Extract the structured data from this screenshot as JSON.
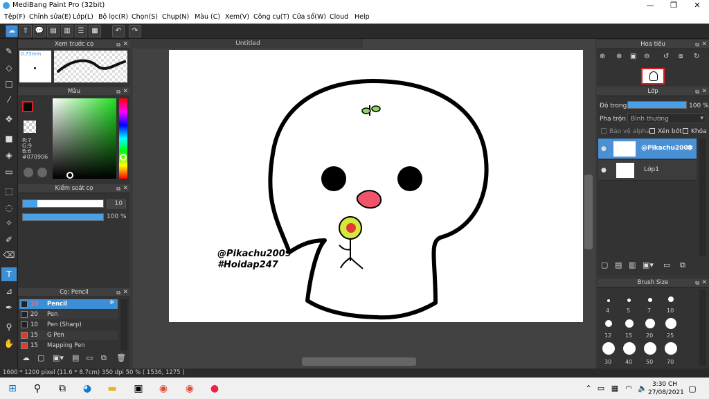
{
  "app": {
    "title": "MediBang Paint Pro (32bit)",
    "min": "—",
    "max": "❐",
    "close": "✕"
  },
  "menu": [
    "Tệp(F)",
    "Chỉnh sửa(E)",
    "Lớp(L)",
    "Bộ lọc(R)",
    "Chọn(S)",
    "Chụp(N)",
    "Màu (C)",
    "Xem(V)",
    "Công cụ(T)",
    "Cửa sổ(W)",
    "Cloud",
    "Help"
  ],
  "preview": {
    "title": "Xem trước cọ",
    "size": "0.73mm"
  },
  "color": {
    "title": "Màu",
    "r": "R:7",
    "g": "G:9",
    "b": "B:6",
    "hex": "#070906",
    "fg": "#070906",
    "accent": "#3c8fd6"
  },
  "brushctrl": {
    "title": "Kiểm soát cọ",
    "size": "10",
    "opacity": "100 %"
  },
  "brushlist": {
    "title": "Cọ: Pencil",
    "items": [
      {
        "size": "10",
        "name": "Pencil",
        "color": "#222222"
      },
      {
        "size": "20",
        "name": "Pen",
        "color": "#222222"
      },
      {
        "size": "10",
        "name": "Pen (Sharp)",
        "color": "#222222"
      },
      {
        "size": "15",
        "name": "G Pen",
        "color": "#e03a2c"
      },
      {
        "size": "15",
        "name": "Mapping Pen",
        "color": "#e03a2c"
      }
    ]
  },
  "canvas": {
    "tab": "Untitled",
    "text1": "@Pikachu2009",
    "text2": "#Hoidap247"
  },
  "navigator": {
    "title": "Hoa tiêu"
  },
  "layers": {
    "title": "Lớp",
    "opacity_label": "Độ trong",
    "opacity_value": "100 %",
    "blend_label": "Pha trộn",
    "blend_value": "Bình thường",
    "protect_alpha": "Bảo vệ alpha",
    "clip": "Xén bớt",
    "lock": "Khóa",
    "items": [
      {
        "name": "@Pikachu2009"
      },
      {
        "name": "Lớp1"
      }
    ]
  },
  "brushsize": {
    "title": "Brush Size",
    "sizes": [
      "4",
      "5",
      "7",
      "10",
      "12",
      "15",
      "20",
      "25",
      "30",
      "40",
      "50",
      "70"
    ]
  },
  "status": "1600 * 1200 pixel   (11.6 * 8.7cm)   350 dpi   50 %   ( 1536, 1275 )",
  "taskbar": {
    "time": "3:30 CH",
    "date": "27/08/2021"
  }
}
